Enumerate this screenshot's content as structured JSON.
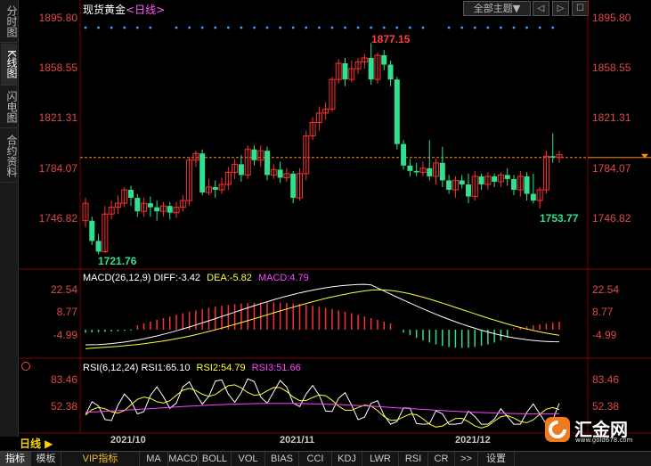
{
  "window": {
    "title": "现货黄金",
    "period": "<日线>",
    "theme_button": "全部主题▼",
    "controls": [
      "◁",
      "▷",
      "☐"
    ]
  },
  "sidebar": {
    "items": [
      {
        "label": "分时图",
        "active": false
      },
      {
        "label": "K线图",
        "active": true
      },
      {
        "label": "闪电图",
        "active": false
      },
      {
        "label": "合约资料",
        "active": false
      }
    ]
  },
  "price_axis": [
    "1895.80",
    "1858.55",
    "1821.31",
    "1784.07",
    "1746.82"
  ],
  "annotations": {
    "high": "1877.15",
    "low": "1721.76",
    "recent_low": "1753.77"
  },
  "macd": {
    "legend": {
      "name": "MACD(26,12,9)",
      "diff": "DIFF:-3.42",
      "dea": "DEA:-5.82",
      "macd": "MACD:4.79"
    },
    "axis": [
      "22.54",
      "8.77",
      "-4.99"
    ]
  },
  "rsi": {
    "legend": {
      "name": "RSI(6,12,24)",
      "rsi1": "RSI1:65.10",
      "rsi2": "RSI2:54.79",
      "rsi3": "RSI3:51.66"
    },
    "axis": [
      "83.46",
      "52.38"
    ]
  },
  "timeline": {
    "period_selector": "日线 ▶",
    "dates": [
      "2021/10",
      "2021/11",
      "2021/12"
    ]
  },
  "bottom_tabs": [
    {
      "label": "指标",
      "active": true,
      "vip": false
    },
    {
      "label": "模板",
      "active": false,
      "vip": false
    },
    {
      "label": "VIP指标",
      "active": false,
      "vip": true
    },
    {
      "label": "MA",
      "active": false,
      "vip": false
    },
    {
      "label": "MACD",
      "active": false,
      "vip": false
    },
    {
      "label": "BOLL",
      "active": false,
      "vip": false
    },
    {
      "label": "VOL",
      "active": false,
      "vip": false
    },
    {
      "label": "BIAS",
      "active": false,
      "vip": false
    },
    {
      "label": "CCI",
      "active": false,
      "vip": false
    },
    {
      "label": "KDJ",
      "active": false,
      "vip": false
    },
    {
      "label": "LWR",
      "active": false,
      "vip": false
    },
    {
      "label": "RSI",
      "active": false,
      "vip": false
    },
    {
      "label": "CR",
      "active": false,
      "vip": false
    },
    {
      "label": ">>",
      "active": false,
      "vip": false
    },
    {
      "label": "设置",
      "active": false,
      "vip": false
    }
  ],
  "logo": {
    "text": "汇金网",
    "url": "www.gold678.com"
  },
  "colors": {
    "up": "#ff3030",
    "down": "#30e090",
    "diff": "#ffffff",
    "dea": "#ffff33",
    "macd_text": "#ff44ff",
    "axis": "#e04848",
    "current_price": "#ff8c00"
  },
  "chart_data": [
    {
      "type": "candlestick",
      "name": "现货黄金 日线",
      "ylim": [
        1721.76,
        1895.8
      ],
      "price_ticks": [
        1895.8,
        1858.55,
        1821.31,
        1784.07,
        1746.82
      ],
      "x_ticks": [
        "2021/10",
        "2021/11",
        "2021/12"
      ],
      "current_price": 1792,
      "candles": [
        [
          1745,
          1758,
          1740,
          1762
        ],
        [
          1745,
          1730,
          1727,
          1748
        ],
        [
          1730,
          1722,
          1720,
          1735
        ],
        [
          1722,
          1750,
          1721,
          1756
        ],
        [
          1750,
          1755,
          1746,
          1760
        ],
        [
          1755,
          1758,
          1750,
          1764
        ],
        [
          1758,
          1768,
          1755,
          1770
        ],
        [
          1768,
          1762,
          1756,
          1771
        ],
        [
          1762,
          1752,
          1748,
          1765
        ],
        [
          1752,
          1758,
          1748,
          1762
        ],
        [
          1758,
          1755,
          1748,
          1763
        ],
        [
          1755,
          1752,
          1745,
          1760
        ],
        [
          1752,
          1756,
          1748,
          1759
        ],
        [
          1756,
          1751,
          1746,
          1759
        ],
        [
          1751,
          1755,
          1747,
          1759
        ],
        [
          1755,
          1760,
          1752,
          1764
        ],
        [
          1760,
          1790,
          1756,
          1792
        ],
        [
          1790,
          1795,
          1785,
          1797
        ],
        [
          1795,
          1766,
          1764,
          1798
        ],
        [
          1766,
          1770,
          1764,
          1776
        ],
        [
          1770,
          1768,
          1762,
          1775
        ],
        [
          1768,
          1772,
          1765,
          1777
        ],
        [
          1772,
          1781,
          1768,
          1785
        ],
        [
          1781,
          1787,
          1776,
          1791
        ],
        [
          1787,
          1779,
          1774,
          1794
        ],
        [
          1779,
          1798,
          1776,
          1801
        ],
        [
          1798,
          1790,
          1786,
          1801
        ],
        [
          1790,
          1797,
          1785,
          1801
        ],
        [
          1797,
          1779,
          1775,
          1800
        ],
        [
          1779,
          1783,
          1776,
          1787
        ],
        [
          1783,
          1777,
          1773,
          1789
        ],
        [
          1777,
          1780,
          1774,
          1784
        ],
        [
          1780,
          1762,
          1758,
          1782
        ],
        [
          1762,
          1780,
          1760,
          1784
        ],
        [
          1780,
          1808,
          1775,
          1812
        ],
        [
          1808,
          1818,
          1805,
          1822
        ],
        [
          1818,
          1825,
          1812,
          1830
        ],
        [
          1825,
          1828,
          1820,
          1833
        ],
        [
          1828,
          1850,
          1826,
          1852
        ],
        [
          1850,
          1862,
          1847,
          1865
        ],
        [
          1862,
          1850,
          1845,
          1866
        ],
        [
          1850,
          1858,
          1848,
          1864
        ],
        [
          1858,
          1863,
          1854,
          1866
        ],
        [
          1863,
          1866,
          1858,
          1869
        ],
        [
          1866,
          1850,
          1846,
          1877
        ],
        [
          1850,
          1868,
          1847,
          1870
        ],
        [
          1868,
          1861,
          1857,
          1872
        ],
        [
          1861,
          1850,
          1845,
          1864
        ],
        [
          1850,
          1802,
          1798,
          1852
        ],
        [
          1802,
          1786,
          1783,
          1805
        ],
        [
          1786,
          1782,
          1778,
          1791
        ],
        [
          1782,
          1781,
          1778,
          1788
        ],
        [
          1781,
          1784,
          1778,
          1789
        ],
        [
          1784,
          1778,
          1775,
          1805
        ],
        [
          1778,
          1788,
          1772,
          1791
        ],
        [
          1788,
          1775,
          1770,
          1800
        ],
        [
          1775,
          1768,
          1765,
          1779
        ],
        [
          1768,
          1775,
          1762,
          1778
        ],
        [
          1775,
          1772,
          1769,
          1779
        ],
        [
          1772,
          1763,
          1758,
          1780
        ],
        [
          1763,
          1778,
          1760,
          1782
        ],
        [
          1778,
          1772,
          1768,
          1780
        ],
        [
          1772,
          1778,
          1768,
          1781
        ],
        [
          1778,
          1774,
          1770,
          1780
        ],
        [
          1774,
          1779,
          1770,
          1781
        ],
        [
          1779,
          1776,
          1771,
          1784
        ],
        [
          1776,
          1768,
          1764,
          1779
        ],
        [
          1768,
          1778,
          1763,
          1782
        ],
        [
          1778,
          1765,
          1760,
          1781
        ],
        [
          1765,
          1760,
          1758,
          1780
        ],
        [
          1760,
          1768,
          1754,
          1770
        ],
        [
          1768,
          1793,
          1765,
          1797
        ],
        [
          1793,
          1792,
          1788,
          1810
        ],
        [
          1792,
          1794,
          1788,
          1797
        ]
      ]
    },
    {
      "type": "bar",
      "name": "MACD",
      "legend": [
        "DIFF:-3.42",
        "DEA:-5.82",
        "MACD:4.79"
      ],
      "ylim": [
        -12,
        28
      ],
      "ticks": [
        22.54,
        8.77,
        -4.99
      ]
    },
    {
      "type": "line",
      "name": "RSI",
      "legend": [
        "RSI1:65.10",
        "RSI2:54.79",
        "RSI3:51.66"
      ],
      "ylim": [
        30,
        100
      ],
      "ticks": [
        83.46,
        52.38
      ]
    }
  ]
}
